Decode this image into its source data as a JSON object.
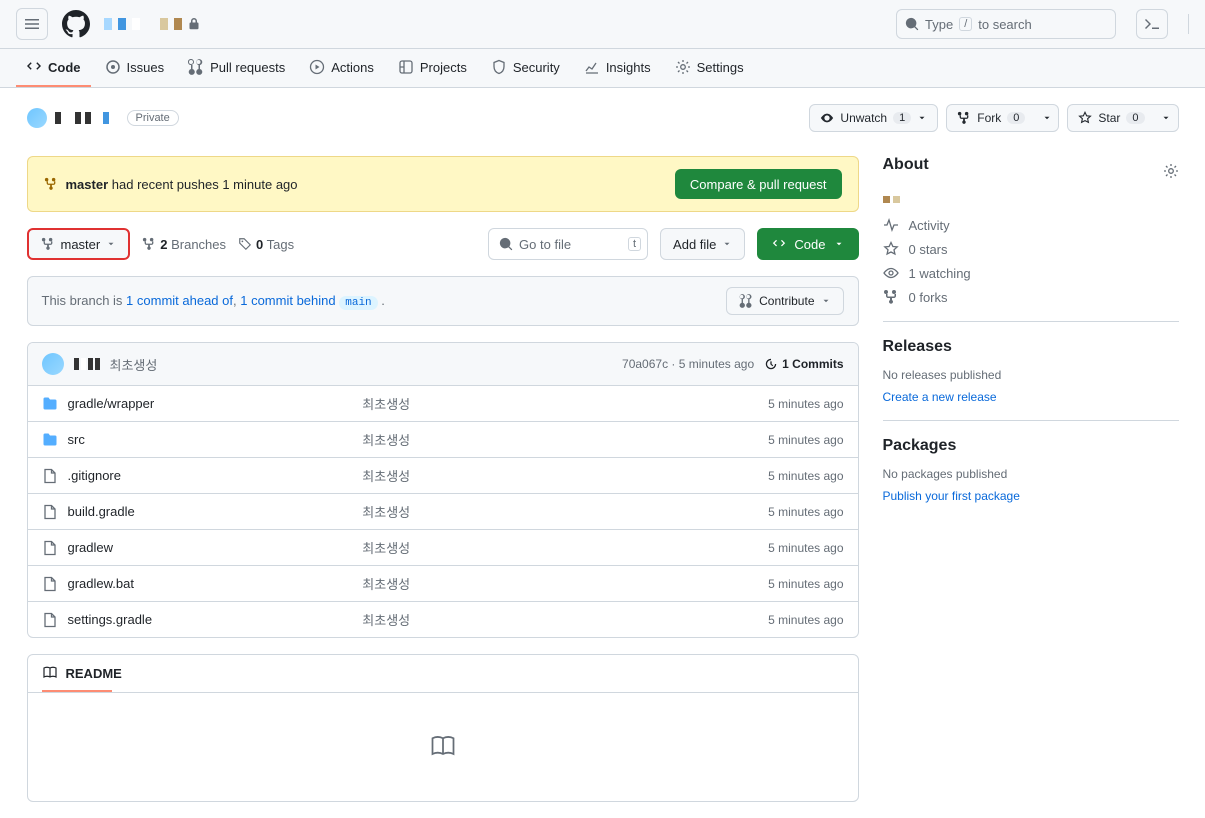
{
  "header": {
    "search_placeholder": "Type",
    "search_suffix": "to search",
    "slash": "/"
  },
  "nav": {
    "code": "Code",
    "issues": "Issues",
    "pulls": "Pull requests",
    "actions": "Actions",
    "projects": "Projects",
    "security": "Security",
    "insights": "Insights",
    "settings": "Settings"
  },
  "repo": {
    "visibility": "Private",
    "unwatch": "Unwatch",
    "unwatch_count": "1",
    "fork": "Fork",
    "fork_count": "0",
    "star": "Star",
    "star_count": "0"
  },
  "banner": {
    "branch": "master",
    "text": "had recent pushes 1 minute ago",
    "button": "Compare & pull request"
  },
  "actions": {
    "branch": "master",
    "branches_count": "2",
    "branches_label": "Branches",
    "tags_count": "0",
    "tags_label": "Tags",
    "goto": "Go to file",
    "goto_key": "t",
    "add_file": "Add file",
    "code": "Code"
  },
  "compare": {
    "prefix": "This branch is",
    "ahead": "1 commit ahead of",
    "behind": "1 commit behind",
    "target": "main",
    "suffix": ".",
    "contribute": "Contribute"
  },
  "commit": {
    "message": "최초생성",
    "sha": "70a067c",
    "time": "5 minutes ago",
    "commits_count": "1 Commits"
  },
  "files": [
    {
      "type": "folder",
      "name": "gradle/wrapper",
      "msg": "최초생성",
      "time": "5 minutes ago"
    },
    {
      "type": "folder",
      "name": "src",
      "msg": "최초생성",
      "time": "5 minutes ago"
    },
    {
      "type": "file",
      "name": ".gitignore",
      "msg": "최초생성",
      "time": "5 minutes ago"
    },
    {
      "type": "file",
      "name": "build.gradle",
      "msg": "최초생성",
      "time": "5 minutes ago"
    },
    {
      "type": "file",
      "name": "gradlew",
      "msg": "최초생성",
      "time": "5 minutes ago"
    },
    {
      "type": "file",
      "name": "gradlew.bat",
      "msg": "최초생성",
      "time": "5 minutes ago"
    },
    {
      "type": "file",
      "name": "settings.gradle",
      "msg": "최초생성",
      "time": "5 minutes ago"
    }
  ],
  "readme": {
    "title": "README"
  },
  "sidebar": {
    "about": "About",
    "activity": "Activity",
    "stars": "0 stars",
    "watching": "1 watching",
    "forks": "0 forks",
    "releases": "Releases",
    "releases_none": "No releases published",
    "releases_link": "Create a new release",
    "packages": "Packages",
    "packages_none": "No packages published",
    "packages_link": "Publish your first package"
  }
}
